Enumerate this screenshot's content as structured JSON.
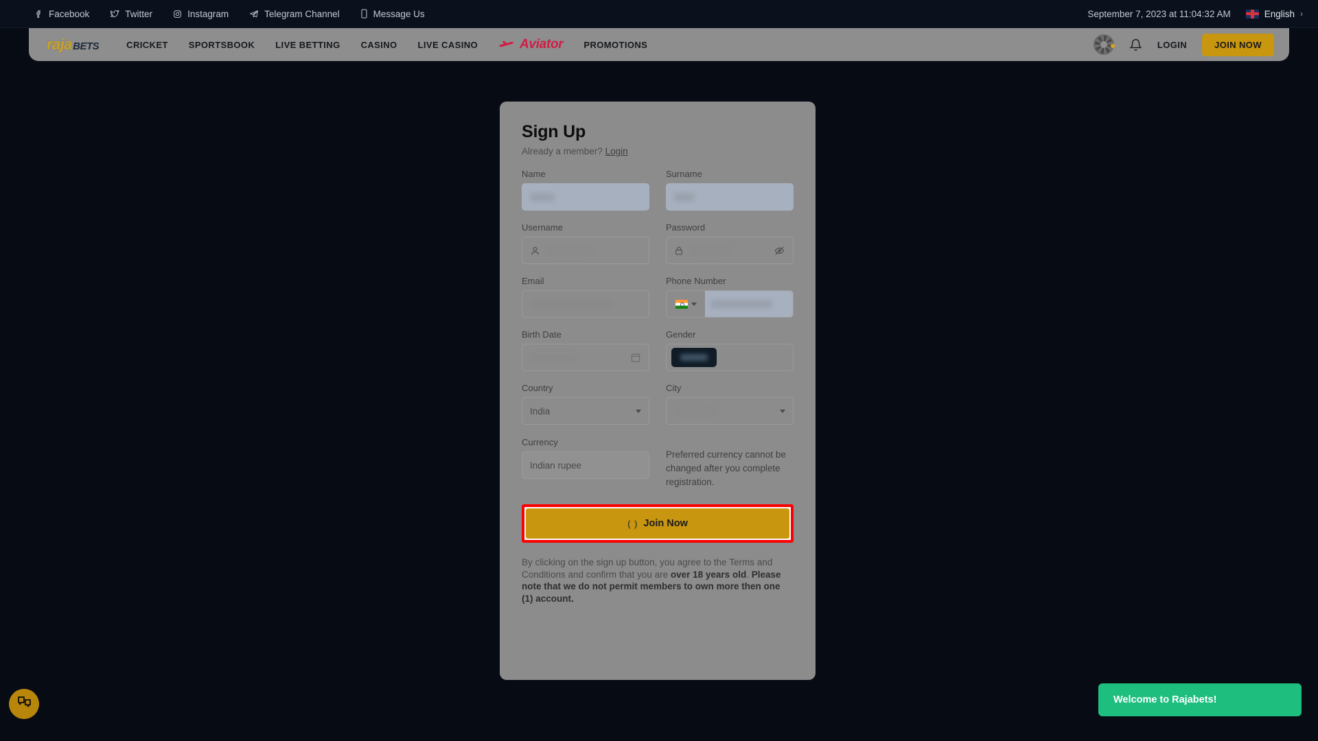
{
  "topbar": {
    "social_links": [
      {
        "label": "Facebook",
        "icon": "facebook-icon"
      },
      {
        "label": "Twitter",
        "icon": "twitter-icon"
      },
      {
        "label": "Instagram",
        "icon": "instagram-icon"
      },
      {
        "label": "Telegram Channel",
        "icon": "telegram-icon"
      },
      {
        "label": "Message Us",
        "icon": "mobile-message-icon"
      }
    ],
    "datetime": "September 7, 2023 at 11:04:32 AM",
    "language": "English",
    "language_chevron": "›"
  },
  "navbar": {
    "logo_primary": "raja",
    "logo_secondary": "BETS",
    "links": [
      "CRICKET",
      "SPORTSBOOK",
      "LIVE BETTING",
      "CASINO",
      "LIVE CASINO"
    ],
    "aviator_label": "Aviator",
    "promotions_label": "PROMOTIONS",
    "login_label": "LOGIN",
    "join_now_label": "JOIN NOW"
  },
  "modal": {
    "title": "Sign Up",
    "already_member_text": "Already a member?",
    "login_link": "Login",
    "fields": {
      "name": {
        "label": "Name",
        "value": "",
        "redacted": true
      },
      "surname": {
        "label": "Surname",
        "value": "",
        "redacted": true
      },
      "username": {
        "label": "Username",
        "value": "",
        "redacted": true
      },
      "password": {
        "label": "Password",
        "value": "",
        "redacted": true
      },
      "email": {
        "label": "Email",
        "value": "",
        "redacted": true
      },
      "phone": {
        "label": "Phone Number",
        "country_code_flag": "india-flag",
        "value": "",
        "redacted": true
      },
      "birth_date": {
        "label": "Birth Date",
        "value": "",
        "redacted": true
      },
      "gender": {
        "label": "Gender",
        "value": "",
        "redacted": true
      },
      "country": {
        "label": "Country",
        "value": "India"
      },
      "city": {
        "label": "City",
        "value": "",
        "redacted": true
      },
      "currency": {
        "label": "Currency",
        "value": "Indian rupee",
        "disabled": true
      }
    },
    "currency_note": "Preferred currency cannot be changed after you complete registration.",
    "submit_label": "Join Now",
    "submit_spinner": "( )",
    "terms": {
      "part1": "By clicking on the sign up button, you agree to the Terms and Conditions and confirm that you are ",
      "bold1": "over 18 years old",
      "part2": ". ",
      "bold2": "Please note that we do not permit members to own more then one (1) account."
    }
  },
  "toast": {
    "message": "Welcome to Rajabets!"
  },
  "chat": {
    "icon": "chat-bubble-icon"
  },
  "colors": {
    "page_background": "#070b14",
    "topbar_background": "#0b111c",
    "overlay_surface": "#8c8c8c",
    "brand_gold": "#c9960f",
    "logo_gold": "#c9a227",
    "aviator_red": "#cf1d45",
    "toast_green": "#1ebe7f",
    "highlight_red": "#ff0000",
    "gender_chip": "#101b26",
    "filled_field": "#a7b0bf"
  }
}
